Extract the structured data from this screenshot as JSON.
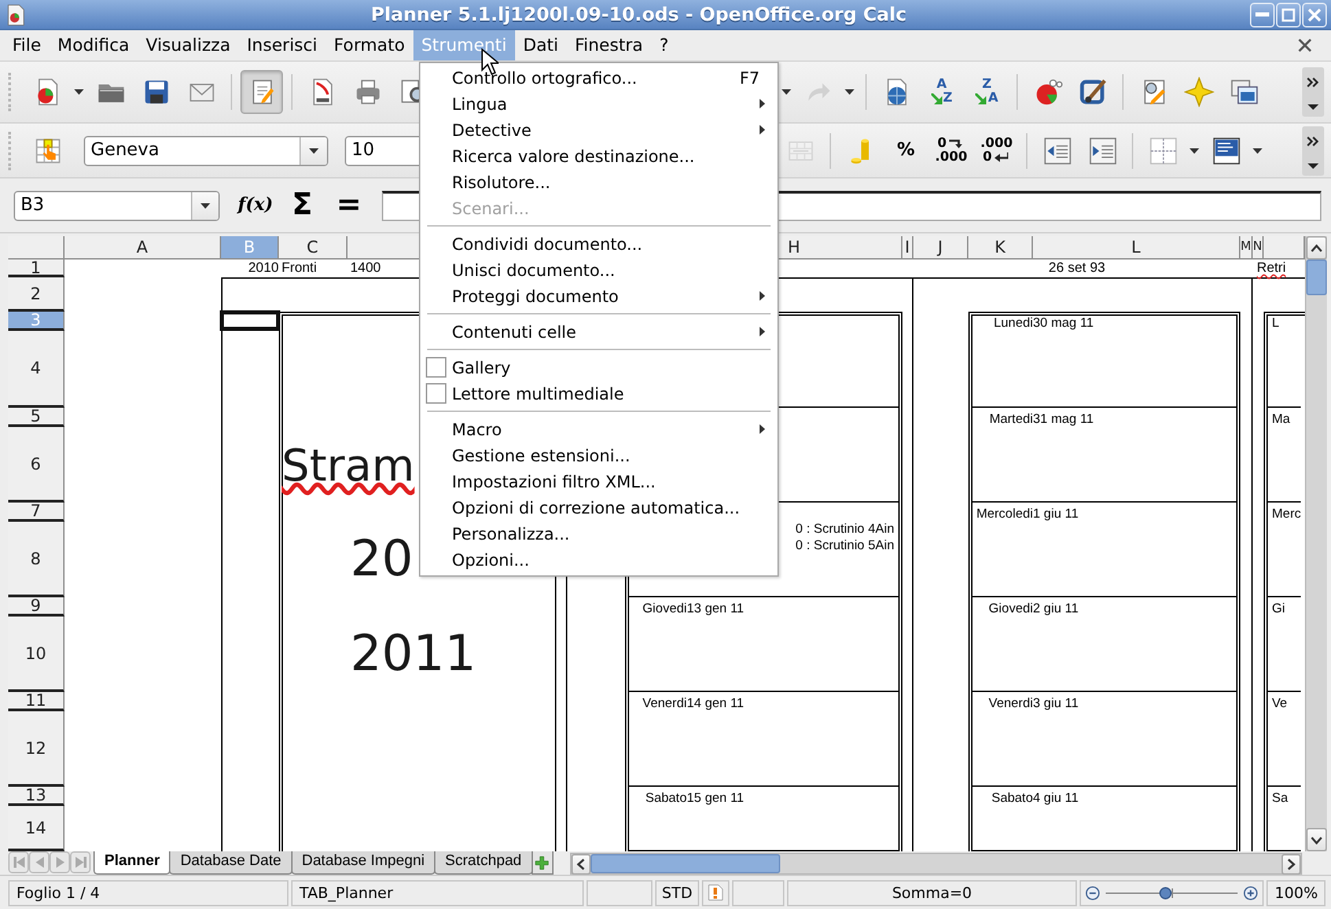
{
  "window": {
    "title": "Planner 5.1.lj1200l.09-10.ods - OpenOffice.org Calc"
  },
  "menu_bar": [
    {
      "label": "File",
      "selected": false
    },
    {
      "label": "Modifica",
      "selected": false
    },
    {
      "label": "Visualizza",
      "selected": false
    },
    {
      "label": "Inserisci",
      "selected": false
    },
    {
      "label": "Formato",
      "selected": false
    },
    {
      "label": "Strumenti",
      "selected": true
    },
    {
      "label": "Dati",
      "selected": false
    },
    {
      "label": "Finestra",
      "selected": false
    },
    {
      "label": "?",
      "selected": false
    }
  ],
  "toolbars": [
    {
      "left": [
        {
          "kind": "new",
          "pressed": false,
          "disabled": false
        },
        {
          "kind": "dropdown_arrow"
        },
        {
          "kind": "open",
          "pressed": false,
          "disabled": false
        },
        {
          "kind": "save",
          "pressed": false,
          "disabled": false
        },
        {
          "kind": "email",
          "pressed": false,
          "disabled": false
        },
        {
          "kind": "separator"
        },
        {
          "kind": "edit",
          "pressed": true,
          "disabled": false
        },
        {
          "kind": "separator"
        },
        {
          "kind": "pdf",
          "pressed": false,
          "disabled": false
        },
        {
          "kind": "print",
          "pressed": false,
          "disabled": false
        },
        {
          "kind": "preview",
          "pressed": false,
          "disabled": false
        }
      ],
      "right": [
        {
          "kind": "dropdown_arrow"
        },
        {
          "kind": "redo",
          "pressed": false,
          "disabled": true
        },
        {
          "kind": "dropdown_arrow"
        },
        {
          "kind": "separator"
        },
        {
          "kind": "hyperlink",
          "pressed": false,
          "disabled": false
        },
        {
          "kind": "sort_ascending",
          "pressed": false,
          "disabled": false,
          "labels": [
            "A",
            "Z"
          ]
        },
        {
          "kind": "sort_descending",
          "pressed": false,
          "disabled": false,
          "labels": [
            "Z",
            "A"
          ]
        },
        {
          "kind": "separator"
        },
        {
          "kind": "chart",
          "pressed": false,
          "disabled": false
        },
        {
          "kind": "draw",
          "pressed": false,
          "disabled": false
        },
        {
          "kind": "separator"
        },
        {
          "kind": "find_edit",
          "pressed": false,
          "disabled": false
        },
        {
          "kind": "gallery",
          "pressed": false,
          "disabled": false
        },
        {
          "kind": "navigator",
          "pressed": false,
          "disabled": false
        }
      ]
    },
    {
      "left": [
        {
          "kind": "cell_styles",
          "pressed": false,
          "disabled": false
        },
        {
          "kind": "font_name",
          "value": "Geneva"
        },
        {
          "kind": "font_size",
          "value": "10"
        }
      ],
      "right": [
        {
          "kind": "merge",
          "pressed": false,
          "disabled": true
        },
        {
          "kind": "separator"
        },
        {
          "kind": "currency",
          "pressed": false,
          "disabled": false
        },
        {
          "kind": "percent",
          "pressed": false,
          "disabled": false,
          "labels": [
            "%"
          ]
        },
        {
          "kind": "add_decimal",
          "pressed": false,
          "disabled": false,
          "labels": [
            "0",
            ".000"
          ]
        },
        {
          "kind": "remove_decimal",
          "pressed": false,
          "disabled": false,
          "labels": [
            ".000",
            "0"
          ]
        },
        {
          "kind": "separator"
        },
        {
          "kind": "indent_decrease",
          "pressed": false,
          "disabled": false
        },
        {
          "kind": "indent_increase",
          "pressed": false,
          "disabled": false
        },
        {
          "kind": "separator"
        },
        {
          "kind": "borders",
          "pressed": false,
          "disabled": false
        },
        {
          "kind": "dropdown_arrow"
        },
        {
          "kind": "background",
          "pressed": false,
          "disabled": false
        },
        {
          "kind": "dropdown_arrow"
        }
      ]
    }
  ],
  "formula_bar": {
    "name_box": "B3",
    "function_wizard": "f(x)",
    "sum": "Σ",
    "formula": "="
  },
  "sheet": {
    "columns": [
      {
        "label": "A",
        "selected": false
      },
      {
        "label": "B",
        "selected": true
      },
      {
        "label": "C",
        "selected": false
      },
      {
        "label": "H",
        "selected": false
      },
      {
        "label": "I",
        "selected": false
      },
      {
        "label": "J",
        "selected": false
      },
      {
        "label": "K",
        "selected": false
      },
      {
        "label": "L",
        "selected": false
      },
      {
        "label": "M",
        "selected": false
      },
      {
        "label": "N",
        "selected": false
      }
    ],
    "rows": [
      {
        "label": "1",
        "selected": false
      },
      {
        "label": "2",
        "selected": false
      },
      {
        "label": "3",
        "selected": true
      },
      {
        "label": "4",
        "selected": false
      },
      {
        "label": "5",
        "selected": false
      },
      {
        "label": "6",
        "selected": false
      },
      {
        "label": "7",
        "selected": false
      },
      {
        "label": "8",
        "selected": false
      },
      {
        "label": "9",
        "selected": false
      },
      {
        "label": "10",
        "selected": false
      },
      {
        "label": "11",
        "selected": false
      },
      {
        "label": "12",
        "selected": false
      },
      {
        "label": "13",
        "selected": false
      },
      {
        "label": "14",
        "selected": false
      }
    ],
    "row_1": [
      {
        "text": "2010",
        "misspelled": false
      },
      {
        "text": "Fronti",
        "misspelled": false
      },
      {
        "text": "1400",
        "misspelled": false
      },
      {
        "text": "26 set 93",
        "misspelled": false
      },
      {
        "text": "Retri",
        "misspelled": true
      }
    ],
    "cover_lines": [
      {
        "text": "Stram",
        "misspelled": true
      },
      {
        "text": "20",
        "misspelled": false
      },
      {
        "text": "2011",
        "misspelled": false
      }
    ],
    "calendars": [
      {
        "days": [
          {
            "kind": "day"
          },
          {
            "kind": "day"
          },
          {
            "kind": "day",
            "notes": [
              "0 : Scrutinio 4Ain",
              "0 : Scrutinio 5Ain"
            ]
          },
          {
            "kind": "day",
            "weekday": "Giovedi",
            "date": "13 gen 11"
          },
          {
            "kind": "day",
            "weekday": "Venerdi",
            "date": "14 gen 11"
          },
          {
            "kind": "day",
            "weekday": "Sabato",
            "date": "15 gen 11"
          }
        ]
      },
      {
        "days": [
          {
            "kind": "day",
            "weekday": "Lunedi",
            "date": "30 mag 11"
          },
          {
            "kind": "day",
            "weekday": "Martedi",
            "date": "31 mag 11"
          },
          {
            "kind": "day",
            "weekday": "Mercoledi",
            "date": "1 giu 11"
          },
          {
            "kind": "day",
            "weekday": "Giovedi",
            "date": "2 giu 11"
          },
          {
            "kind": "day",
            "weekday": "Venerdi",
            "date": "3 giu 11"
          },
          {
            "kind": "day",
            "weekday": "Sabato",
            "date": "4 giu 11"
          }
        ]
      },
      {
        "days": [
          {
            "kind": "day",
            "weekday": "L"
          },
          {
            "kind": "day",
            "weekday": "Ma"
          },
          {
            "kind": "day",
            "weekday": "Merc"
          },
          {
            "kind": "day",
            "weekday": "Gi"
          },
          {
            "kind": "day",
            "weekday": "Ve"
          },
          {
            "kind": "day",
            "weekday": "Sa"
          }
        ]
      }
    ]
  },
  "sheet_tabs": [
    {
      "label": "Planner",
      "selected": true
    },
    {
      "label": "Database Date",
      "selected": false
    },
    {
      "label": "Database Impegni",
      "selected": false
    },
    {
      "label": "Scratchpad",
      "selected": false
    }
  ],
  "status_bar": {
    "sheet": "Foglio 1 / 4",
    "page_style": "TAB_Planner",
    "mode": "STD",
    "modified": true,
    "sum": "Somma=0",
    "zoom": {
      "level": 0.45,
      "reading": "100%"
    }
  },
  "open_menu": {
    "items": [
      {
        "kind": "item",
        "label": "Controllo ortografico...",
        "shortcut": "F7",
        "submenu": false,
        "disabled": false
      },
      {
        "kind": "item",
        "label": "Lingua",
        "submenu": true,
        "disabled": false
      },
      {
        "kind": "item",
        "label": "Detective",
        "submenu": true,
        "disabled": false
      },
      {
        "kind": "item",
        "label": "Ricerca valore destinazione...",
        "submenu": false,
        "disabled": false
      },
      {
        "kind": "item",
        "label": "Risolutore...",
        "submenu": false,
        "disabled": false
      },
      {
        "kind": "item",
        "label": "Scenari...",
        "submenu": false,
        "disabled": true
      },
      {
        "kind": "separator"
      },
      {
        "kind": "item",
        "label": "Condividi documento...",
        "submenu": false,
        "disabled": false
      },
      {
        "kind": "item",
        "label": "Unisci documento...",
        "submenu": false,
        "disabled": false
      },
      {
        "kind": "item",
        "label": "Proteggi documento",
        "submenu": true,
        "disabled": false
      },
      {
        "kind": "separator"
      },
      {
        "kind": "item",
        "label": "Contenuti celle",
        "submenu": true,
        "disabled": false
      },
      {
        "kind": "separator"
      },
      {
        "kind": "check",
        "label": "Gallery",
        "checked": false,
        "submenu": false,
        "disabled": false
      },
      {
        "kind": "check",
        "label": "Lettore multimediale",
        "checked": false,
        "submenu": false,
        "disabled": false
      },
      {
        "kind": "separator"
      },
      {
        "kind": "item",
        "label": "Macro",
        "submenu": true,
        "disabled": false
      },
      {
        "kind": "item",
        "label": "Gestione estensioni...",
        "submenu": false,
        "disabled": false
      },
      {
        "kind": "item",
        "label": "Impostazioni filtro XML...",
        "submenu": false,
        "disabled": false
      },
      {
        "kind": "item",
        "label": "Opzioni di correzione automatica...",
        "submenu": false,
        "disabled": false
      },
      {
        "kind": "item",
        "label": "Personalizza...",
        "submenu": false,
        "disabled": false
      },
      {
        "kind": "item",
        "label": "Opzioni...",
        "submenu": false,
        "disabled": false
      }
    ]
  }
}
